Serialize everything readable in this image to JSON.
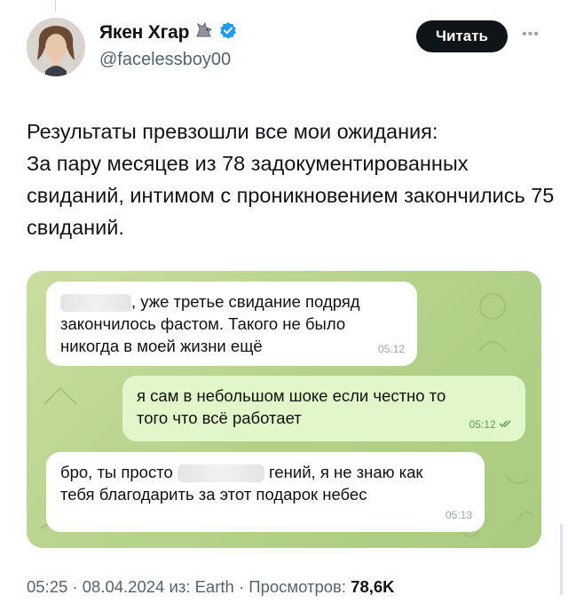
{
  "author": {
    "display_name": "Якен Хгар",
    "handle": "@facelessboy00",
    "verified": true
  },
  "follow_button": {
    "label": "Читать"
  },
  "tweet": {
    "text": "Результаты превзошли все мои ожидания:\nЗа пару месяцев из 78 задокументированных свиданий, интимом с проникновением закончились 75 свиданий."
  },
  "chat": {
    "messages": [
      {
        "direction": "incoming",
        "text_after_blur": ", уже третье свидание подряд\nзакончилось фастом. Такого не было\nникогда в моей жизни ещё",
        "time": "05:12"
      },
      {
        "direction": "outgoing",
        "text": "я сам в небольшом шоке если честно то\nтого что всё работает",
        "time": "05:12",
        "status": "read"
      },
      {
        "direction": "incoming",
        "text_before_blur": "бро, ты просто",
        "text_after_blur": "гений, я не знаю как\nтебя благодарить за этот подарок небес",
        "time": "05:13"
      }
    ]
  },
  "meta": {
    "time": "05:25",
    "date": "08.04.2024",
    "source_prefix": "из:",
    "source": "Earth",
    "views_label": "Просмотров:",
    "views": "78,6K"
  },
  "colors": {
    "verified": "#1d9bf0",
    "chat_background": "#b6d38c",
    "outgoing_bubble": "#e2f7c9",
    "read_ticks": "#57a24a"
  },
  "icons": {
    "name_emoji": "wolf-icon",
    "verified": "verified-badge-icon",
    "more": "more-icon",
    "read_status": "double-check-icon"
  }
}
